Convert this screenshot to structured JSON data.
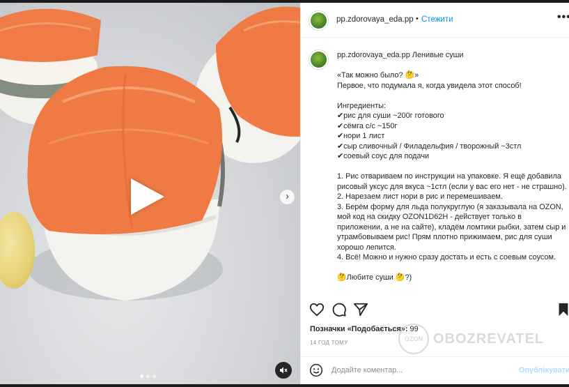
{
  "post": {
    "username": "pp.zdorovaya_eda.pp",
    "separator": "•",
    "follow_label": "Стежити",
    "more_label": "•••",
    "caption_title": "Ленивые суши",
    "caption_lines": [
      "«Так можно было? 🤔»",
      "Первое, что подумала я, когда увидела этот способ!",
      "",
      "Ингредиенты:",
      "✔рис для суши ~200г готового",
      "✔сёмга с/с ~150г",
      "✔нори 1 лист",
      "✔сыр сливочный / Филадельфия / творожный ~3стл",
      "✔соевый соус для подачи",
      "",
      "1. Рис отвариваем по инструкции на упаковке. Я ещё добавила",
      "рисовый уксус для вкуса ~1стл (если у вас его нет - не страшно).",
      "2. Нарезаем лист нори в рис и перемешиваем.",
      "3. Берём форму для льда полукруглую (я заказывала на OZON,",
      "мой код на скидку OZON1D62H - действует только в",
      "приложении, а не на сайте), кладём ломтики рыбки, затем сыр и",
      "утрамбовываем рис! Прям плотно прижимаем, рис для суши",
      "хорошо лепится.",
      "4. Всё! Можно и нужно сразу достать и есть с соевым соусом.",
      "",
      "🤔Любите суши 🤔?)"
    ],
    "likes_label": "Позначки «Подобається»:",
    "likes_count": "99",
    "time_ago": "14 ГОД ТОМУ",
    "comment_placeholder": "Додайте коментар...",
    "post_button": "Опублікувати",
    "watermark_circle": "OZON",
    "watermark_text": "OBOZREVATEL"
  },
  "media": {
    "type": "video",
    "carousel_count": 3,
    "carousel_active": 1
  },
  "colors": {
    "accent": "#0095f6",
    "post_disabled": "#b3dbff",
    "salmon": "#f07a45"
  },
  "icons": [
    "heart-icon",
    "comment-icon",
    "share-icon",
    "bookmark-icon",
    "emoji-icon",
    "play-icon",
    "mute-icon",
    "chevron-right-icon"
  ]
}
